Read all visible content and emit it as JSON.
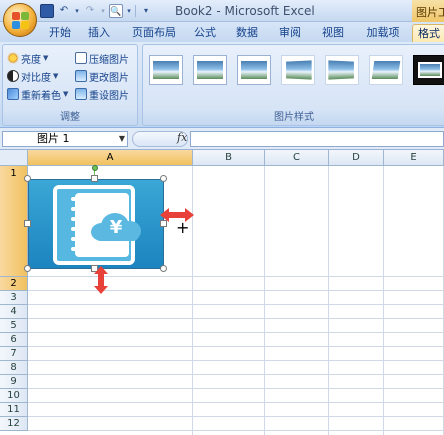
{
  "titlebar": {
    "window_title": "Book2 - Microsoft Excel",
    "context_tab_title": "图片工具",
    "icons": [
      "office-button",
      "save-icon",
      "undo-icon",
      "redo-icon",
      "print-preview-icon",
      "qat-dropdown-icon"
    ]
  },
  "tabs": [
    {
      "label": "开始",
      "active": false
    },
    {
      "label": "插入",
      "active": false
    },
    {
      "label": "页面布局",
      "active": false
    },
    {
      "label": "公式",
      "active": false
    },
    {
      "label": "数据",
      "active": false
    },
    {
      "label": "审阅",
      "active": false
    },
    {
      "label": "视图",
      "active": false
    },
    {
      "label": "加载项",
      "active": false
    },
    {
      "label": "格式",
      "active": true
    }
  ],
  "ribbon": {
    "adjust_group": {
      "label": "调整",
      "brightness": "亮度",
      "contrast": "对比度",
      "recolor": "重新着色",
      "compress": "压缩图片",
      "change_picture": "更改图片",
      "reset_picture": "重设图片"
    },
    "styles_group": {
      "label": "图片样式"
    }
  },
  "formula_bar": {
    "name_box": "图片 1",
    "fx_label": "fx",
    "formula": ""
  },
  "sheet": {
    "columns": [
      "A",
      "B",
      "C",
      "D",
      "E"
    ],
    "selected_column": "A",
    "rows": [
      "1",
      "2",
      "3",
      "4",
      "5",
      "6",
      "7",
      "8",
      "9",
      "10",
      "11",
      "12"
    ],
    "selected_rows": [
      "1",
      "2"
    ]
  },
  "picture": {
    "name": "图片 1",
    "symbol": "¥"
  },
  "colors": {
    "selection_header": "#f1c15f",
    "resize_arrow": "#e8413a",
    "picture_blue": "#1c84bf"
  }
}
